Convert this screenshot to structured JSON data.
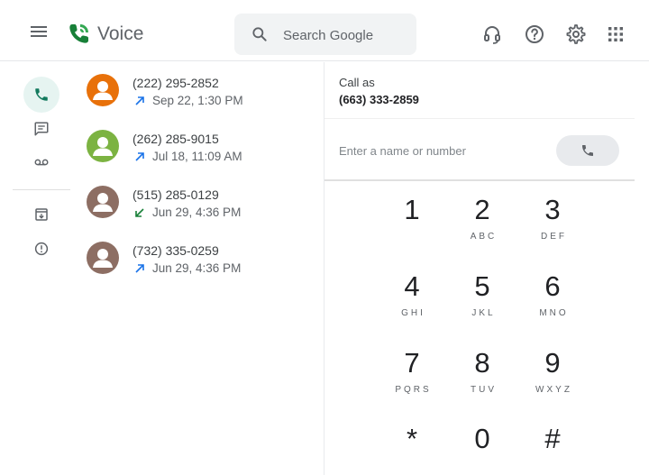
{
  "app": {
    "title": "Voice"
  },
  "search": {
    "placeholder": "Search Google"
  },
  "header_icons": [
    "support-icon",
    "help-icon",
    "settings-icon",
    "apps-icon"
  ],
  "rail": {
    "items": [
      "calls-icon",
      "messages-icon",
      "voicemail-icon",
      "archive-icon",
      "spam-icon"
    ]
  },
  "calls": [
    {
      "number": "(222) 295-2852",
      "time": "Sep 22, 1:30 PM",
      "direction": "outgoing",
      "avatar_color": "#e8710a"
    },
    {
      "number": "(262) 285-9015",
      "time": "Jul 18, 11:09 AM",
      "direction": "outgoing",
      "avatar_color": "#7cb342"
    },
    {
      "number": "(515) 285-0129",
      "time": "Jun 29, 4:36 PM",
      "direction": "incoming",
      "avatar_color": "#8d6e63"
    },
    {
      "number": "(732) 335-0259",
      "time": "Jun 29, 4:36 PM",
      "direction": "outgoing",
      "avatar_color": "#8d6e63"
    }
  ],
  "call_as": {
    "label": "Call as",
    "number": "(663) 333-2859"
  },
  "dialer": {
    "placeholder": "Enter a name or number",
    "keys": [
      {
        "digit": "1",
        "letters": ""
      },
      {
        "digit": "2",
        "letters": "ABC"
      },
      {
        "digit": "3",
        "letters": "DEF"
      },
      {
        "digit": "4",
        "letters": "GHI"
      },
      {
        "digit": "5",
        "letters": "JKL"
      },
      {
        "digit": "6",
        "letters": "MNO"
      },
      {
        "digit": "7",
        "letters": "PQRS"
      },
      {
        "digit": "8",
        "letters": "TUV"
      },
      {
        "digit": "9",
        "letters": "WXYZ"
      },
      {
        "digit": "*",
        "letters": ""
      },
      {
        "digit": "0",
        "letters": ""
      },
      {
        "digit": "#",
        "letters": ""
      }
    ]
  },
  "colors": {
    "accent": "#137a5e",
    "outgoing": "#1a73e8",
    "incoming": "#188038"
  }
}
